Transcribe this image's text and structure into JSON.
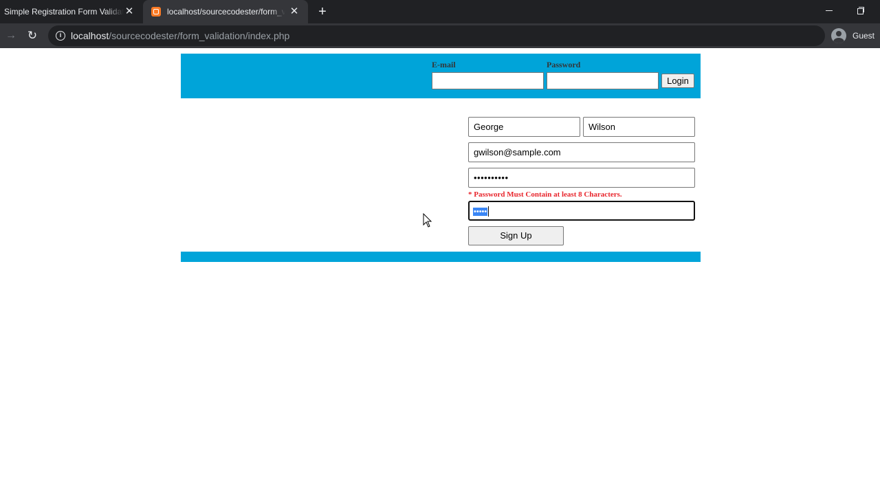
{
  "browser": {
    "tabs": [
      {
        "title": "Simple Registration Form Validation",
        "active": false
      },
      {
        "title": "localhost/sourcecodester/form_validation",
        "active": true
      }
    ],
    "url_host": "localhost",
    "url_path": "/sourcecodester/form_validation/index.php",
    "profile_label": "Guest"
  },
  "login": {
    "email_label": "E-mail",
    "password_label": "Password",
    "email_value": "",
    "password_value": "",
    "button_label": "Login"
  },
  "signup": {
    "first_name": "George",
    "last_name": "Wilson",
    "email": "gwilson@sample.com",
    "password_masked": "••••••••••",
    "error_message": "* Password Must Contain at least 8 Characters.",
    "confirm_masked": "•••••",
    "button_label": "Sign Up"
  },
  "colors": {
    "brand_bar": "#00a4d9",
    "error": "#e8262d"
  }
}
